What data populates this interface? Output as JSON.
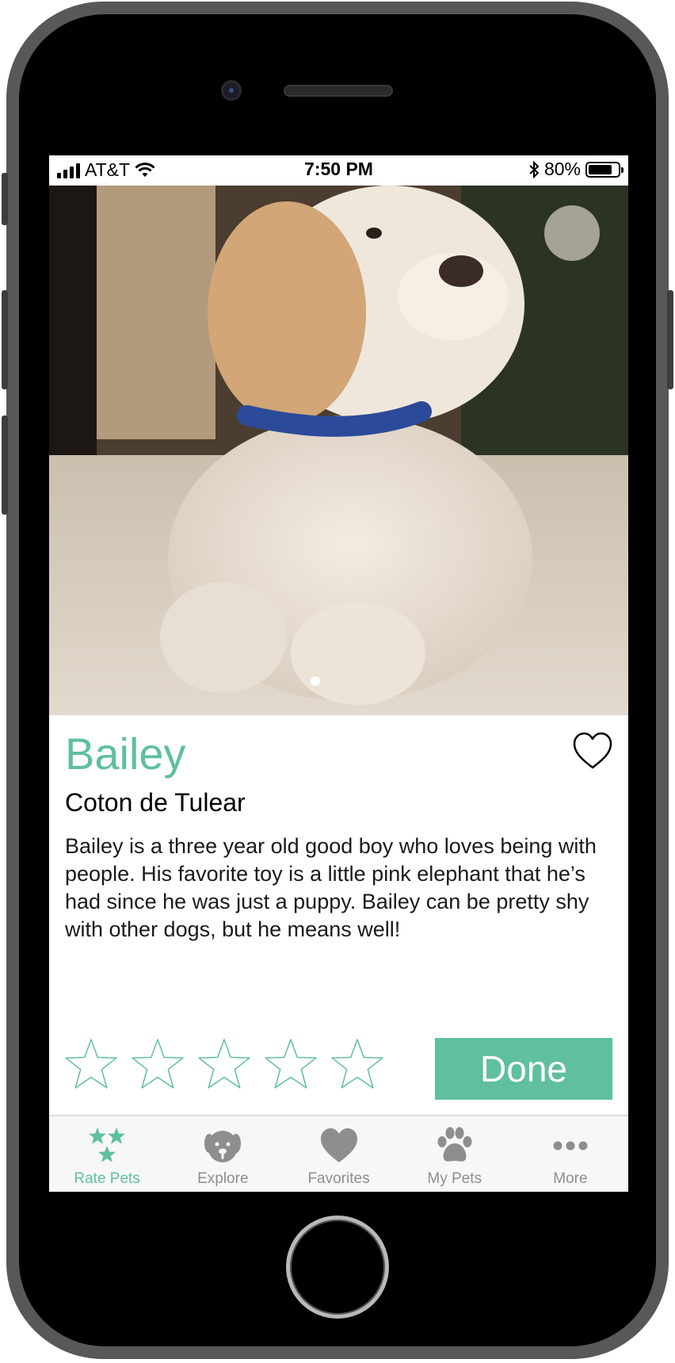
{
  "status_bar": {
    "carrier": "AT&T",
    "time": "7:50 PM",
    "battery_percent": "80%",
    "battery_level": 0.8
  },
  "pet": {
    "photo_subject": "dog-photo",
    "name": "Bailey",
    "breed": "Coton de Tulear",
    "description": "Bailey is a three year old good boy who loves being with people. His favorite toy is a little pink elephant that he’s had since he was just a puppy. Bailey can be pretty shy with other dogs, but he means well!",
    "favorite": false
  },
  "photo_pager": {
    "current": 1,
    "total": 1
  },
  "rating": {
    "max": 5,
    "value": 0
  },
  "actions": {
    "done_label": "Done"
  },
  "tab_bar": {
    "tabs": [
      {
        "label": "Rate Pets",
        "icon": "stars-icon",
        "active": true
      },
      {
        "label": "Explore",
        "icon": "dog-face-icon",
        "active": false
      },
      {
        "label": "Favorites",
        "icon": "heart-icon",
        "active": false
      },
      {
        "label": "My Pets",
        "icon": "paw-icon",
        "active": false
      },
      {
        "label": "More",
        "icon": "more-dots-icon",
        "active": false
      }
    ]
  },
  "colors": {
    "accent": "#5fbf9f",
    "inactive_tab": "#8e8e8e",
    "tab_bar_bg": "#f7f7f7"
  }
}
